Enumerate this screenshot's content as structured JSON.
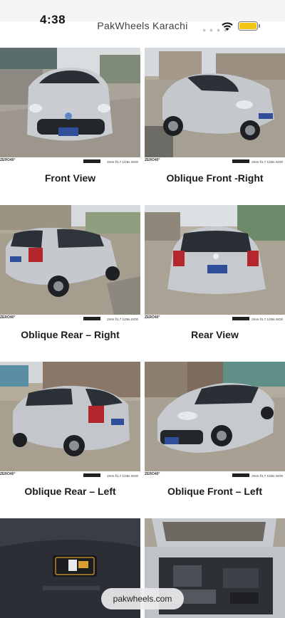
{
  "status": {
    "time": "4:38"
  },
  "browser": {
    "title": "PakWheels Karachi"
  },
  "photo_caption": {
    "brand": "ZERO40°",
    "detail": "2mm f/1.7 1/25s ISO0"
  },
  "gallery": [
    {
      "label": "Front View"
    },
    {
      "label": "Oblique Front -Right"
    },
    {
      "label": "Oblique Rear – Right"
    },
    {
      "label": "Rear View"
    },
    {
      "label": "Oblique Rear – Left"
    },
    {
      "label": "Oblique Front – Left"
    }
  ],
  "footer": {
    "domain_pill": "pakwheels.com"
  },
  "colors": {
    "car_silver": "#c8ccd1",
    "plate_blue": "#2f4f9a",
    "battery": "#f2c511"
  }
}
